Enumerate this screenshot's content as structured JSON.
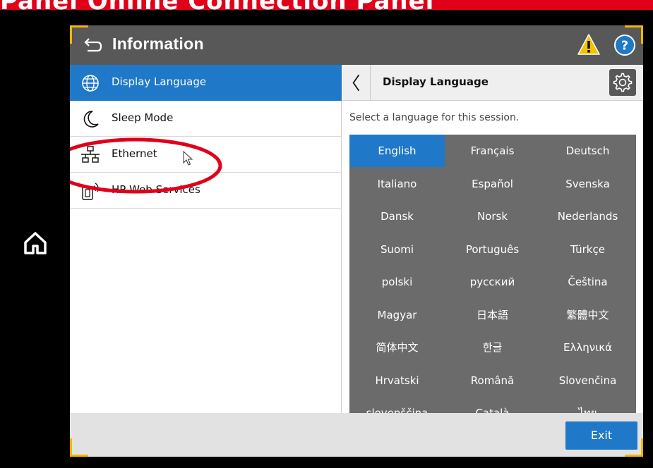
{
  "banner": {
    "text": "Panel Online Connection Panel"
  },
  "header": {
    "title": "Information"
  },
  "menu": {
    "items": [
      {
        "label": "Display Language",
        "icon": "globe-icon",
        "selected": true
      },
      {
        "label": "Sleep Mode",
        "icon": "moon-icon",
        "selected": false
      },
      {
        "label": "Ethernet",
        "icon": "network-icon",
        "selected": false
      },
      {
        "label": "HP Web Services",
        "icon": "web-services-icon",
        "selected": false
      }
    ]
  },
  "panel": {
    "title": "Display Language",
    "subtitle": "Select a language for this session.",
    "languages": [
      "English",
      "Français",
      "Deutsch",
      "Italiano",
      "Español",
      "Svenska",
      "Dansk",
      "Norsk",
      "Nederlands",
      "Suomi",
      "Português",
      "Türkçe",
      "polski",
      "русский",
      "Čeština",
      "Magyar",
      "日本語",
      "繁體中文",
      "简体中文",
      "한글",
      "Ελληνικά",
      "Hrvatski",
      "Română",
      "Slovenčina",
      "slovenščina",
      "Català",
      "ไทย"
    ],
    "selected_language": "English"
  },
  "footer": {
    "exit_label": "Exit"
  },
  "colors": {
    "accent": "#1f78c8",
    "header": "#585858",
    "corner": "#f3b600",
    "highlight": "#e0001a"
  }
}
